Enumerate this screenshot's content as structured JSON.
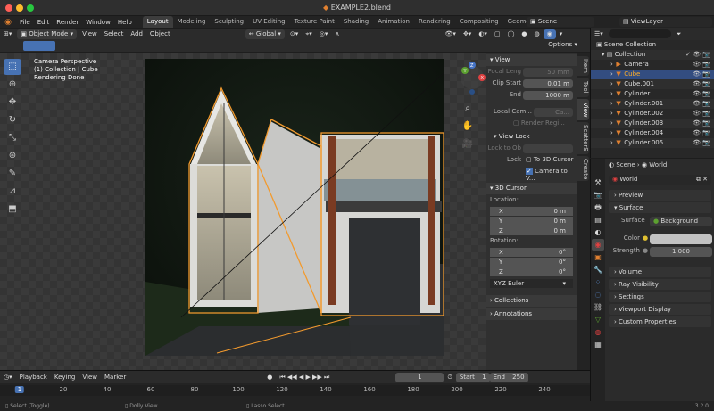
{
  "window": {
    "title": "EXAMPLE2.blend"
  },
  "menu": [
    "File",
    "Edit",
    "Render",
    "Window",
    "Help"
  ],
  "workspaces": [
    {
      "label": "Layout",
      "active": true
    },
    {
      "label": "Modeling"
    },
    {
      "label": "Sculpting"
    },
    {
      "label": "UV Editing"
    },
    {
      "label": "Texture Paint"
    },
    {
      "label": "Shading"
    },
    {
      "label": "Animation"
    },
    {
      "label": "Rendering"
    },
    {
      "label": "Compositing"
    },
    {
      "label": "Geometry Nodes"
    }
  ],
  "scene_name": "Scene",
  "view_layer": "ViewLayer",
  "viewport_header": {
    "mode": "Object Mode",
    "items": [
      "View",
      "Select",
      "Add",
      "Object"
    ],
    "orientation": "Global",
    "options": "Options"
  },
  "overlay": {
    "line1": "Camera Perspective",
    "line2": "(1) Collection | Cube",
    "line3": "Rendering Done"
  },
  "npanel": {
    "tabs": [
      "Item",
      "Tool",
      "View",
      "ScatterS",
      "Create"
    ],
    "view": {
      "header": "View",
      "focal_label": "Focal Leng",
      "focal_value": "50 mm",
      "clip_start_label": "Clip Start",
      "clip_start": "0.01 m",
      "end_label": "End",
      "clip_end": "1000 m",
      "local_cam_label": "Local Cam...",
      "local_cam_value": "Ca...",
      "render_region": "Render Regi...",
      "view_lock": "View Lock",
      "lock_to_obj": "Lock to Ob",
      "lock_label": "Lock",
      "to_3d_cursor": "To 3D Cursor",
      "camera_to_view": "Camera to V..."
    },
    "cursor": {
      "header": "3D Cursor",
      "location": "Location:",
      "x": "0 m",
      "y": "0 m",
      "z": "0 m",
      "rotation": "Rotation:",
      "rx": "0°",
      "ry": "0°",
      "rz": "0°",
      "euler": "XYZ Euler"
    },
    "collections": "Collections",
    "annotations": "Annotations"
  },
  "outliner": {
    "title": "Scene Collection",
    "collection": "Collection",
    "items": [
      "Camera",
      "Cube",
      "Cube.001",
      "Cylinder",
      "Cylinder.001",
      "Cylinder.002",
      "Cylinder.003",
      "Cylinder.004",
      "Cylinder.005"
    ]
  },
  "properties": {
    "breadcrumb_scene": "Scene",
    "breadcrumb_world": "World",
    "world_name": "World",
    "sections": {
      "preview": "Preview",
      "surface": "Surface",
      "surface_label": "Surface",
      "surface_value": "Background",
      "color_label": "Color",
      "strength_label": "Strength",
      "strength_value": "1.000",
      "volume": "Volume",
      "ray_visibility": "Ray Visibility",
      "settings": "Settings",
      "viewport_display": "Viewport Display",
      "custom_props": "Custom Properties"
    }
  },
  "timeline": {
    "items": [
      "Playback",
      "Keying",
      "View",
      "Marker"
    ],
    "current_frame": "1",
    "start_label": "Start",
    "start": "1",
    "end_label": "End",
    "end": "250",
    "ticks": [
      "1",
      "20",
      "40",
      "60",
      "80",
      "100",
      "120",
      "140",
      "160",
      "180",
      "200",
      "220",
      "240"
    ]
  },
  "status": {
    "select": "Select (Toggle)",
    "dolly": "Dolly View",
    "lasso": "Lasso Select",
    "version": "3.2.0"
  },
  "colors": {
    "accent": "#4772b3",
    "select_orange": "#f29a2e"
  }
}
